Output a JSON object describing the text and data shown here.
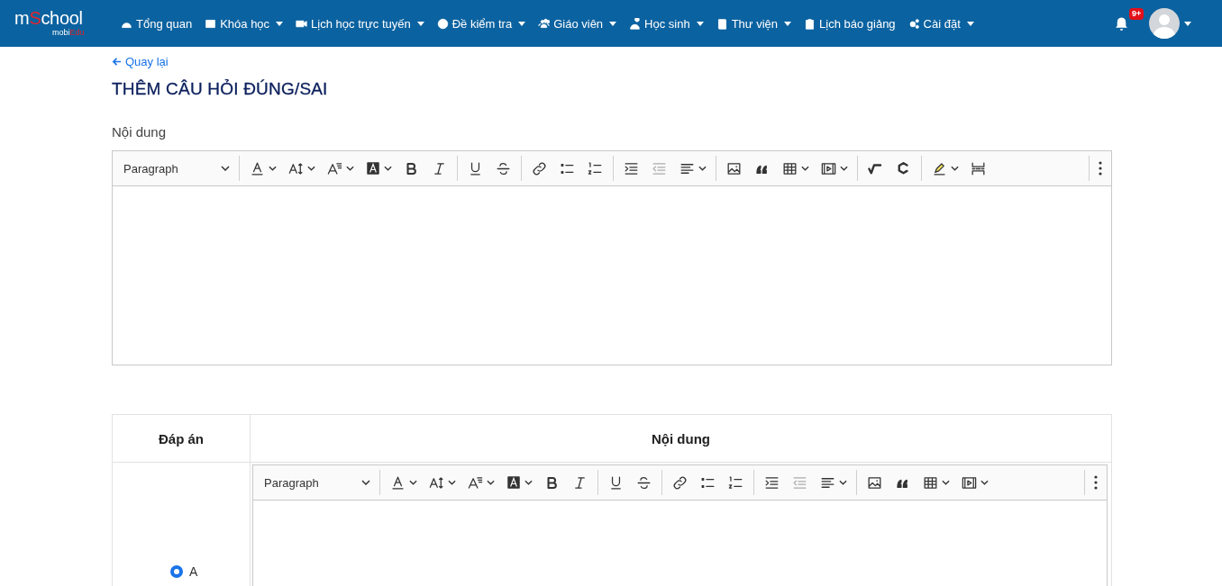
{
  "navbar": {
    "logo": {
      "parts": [
        {
          "text": "m",
          "accent": false
        },
        {
          "text": "S",
          "accent": true
        },
        {
          "text": "chool",
          "accent": false
        }
      ],
      "sub": [
        {
          "text": "mobi",
          "accent": false
        },
        {
          "text": "Edu",
          "accent": true
        }
      ]
    },
    "items": [
      {
        "label": "Tổng quan",
        "dropdown": false
      },
      {
        "label": "Khóa học",
        "dropdown": true
      },
      {
        "label": "Lịch học trực tuyến",
        "dropdown": true
      },
      {
        "label": "Đề kiểm tra",
        "dropdown": true
      },
      {
        "label": "Giáo viên",
        "dropdown": true
      },
      {
        "label": "Học sinh",
        "dropdown": true
      },
      {
        "label": "Thư viện",
        "dropdown": true
      },
      {
        "label": "Lịch báo giảng",
        "dropdown": false
      },
      {
        "label": "Cài đặt",
        "dropdown": true
      }
    ],
    "notifications": {
      "badge": "9+"
    },
    "profile": {
      "dropdown": true
    }
  },
  "back_link": "Quay lại",
  "title": "THÊM CÂU HỎI ĐÚNG/SAI",
  "content": {
    "label": "Nội dung",
    "editor": {
      "format": "Paragraph",
      "groups": [
        [
          {
            "kind": "font-color",
            "dropdown": true
          },
          {
            "kind": "font-size",
            "dropdown": true
          },
          {
            "kind": "font-family",
            "dropdown": true
          },
          {
            "kind": "font-bg",
            "dropdown": true
          },
          {
            "kind": "bold",
            "dropdown": false
          },
          {
            "kind": "italic",
            "dropdown": false
          }
        ],
        [
          {
            "kind": "underline",
            "dropdown": false
          },
          {
            "kind": "strike",
            "dropdown": false
          }
        ],
        [
          {
            "kind": "link",
            "dropdown": false
          },
          {
            "kind": "bullet",
            "dropdown": false
          },
          {
            "kind": "number",
            "dropdown": false
          }
        ],
        [
          {
            "kind": "indent",
            "dropdown": false
          },
          {
            "kind": "outdent",
            "dropdown": false
          },
          {
            "kind": "align",
            "dropdown": true
          }
        ],
        [
          {
            "kind": "image",
            "dropdown": false
          },
          {
            "kind": "quote",
            "dropdown": false
          },
          {
            "kind": "table",
            "dropdown": true
          },
          {
            "kind": "media",
            "dropdown": true
          }
        ],
        [
          {
            "kind": "math",
            "dropdown": false
          },
          {
            "kind": "chem",
            "dropdown": false
          }
        ],
        [
          {
            "kind": "highlight",
            "dropdown": true
          },
          {
            "kind": "pagebreak",
            "dropdown": false
          }
        ]
      ]
    }
  },
  "answers": {
    "columns": [
      "Đáp án",
      "Nội dung"
    ],
    "rows": [
      {
        "label": "A",
        "selected": true,
        "editor": {
          "format": "Paragraph",
          "groups": [
            [
              {
                "kind": "font-color",
                "dropdown": true
              },
              {
                "kind": "font-size",
                "dropdown": true
              },
              {
                "kind": "font-family",
                "dropdown": true
              },
              {
                "kind": "font-bg",
                "dropdown": true
              },
              {
                "kind": "bold",
                "dropdown": false
              },
              {
                "kind": "italic",
                "dropdown": false
              }
            ],
            [
              {
                "kind": "underline",
                "dropdown": false
              },
              {
                "kind": "strike",
                "dropdown": false
              }
            ],
            [
              {
                "kind": "link",
                "dropdown": false
              },
              {
                "kind": "bullet",
                "dropdown": false
              },
              {
                "kind": "number",
                "dropdown": false
              }
            ],
            [
              {
                "kind": "indent",
                "dropdown": false
              },
              {
                "kind": "outdent",
                "dropdown": false
              },
              {
                "kind": "align",
                "dropdown": true
              }
            ],
            [
              {
                "kind": "image",
                "dropdown": false
              },
              {
                "kind": "quote",
                "dropdown": false
              },
              {
                "kind": "table",
                "dropdown": true
              },
              {
                "kind": "media",
                "dropdown": true
              }
            ]
          ]
        }
      }
    ]
  }
}
